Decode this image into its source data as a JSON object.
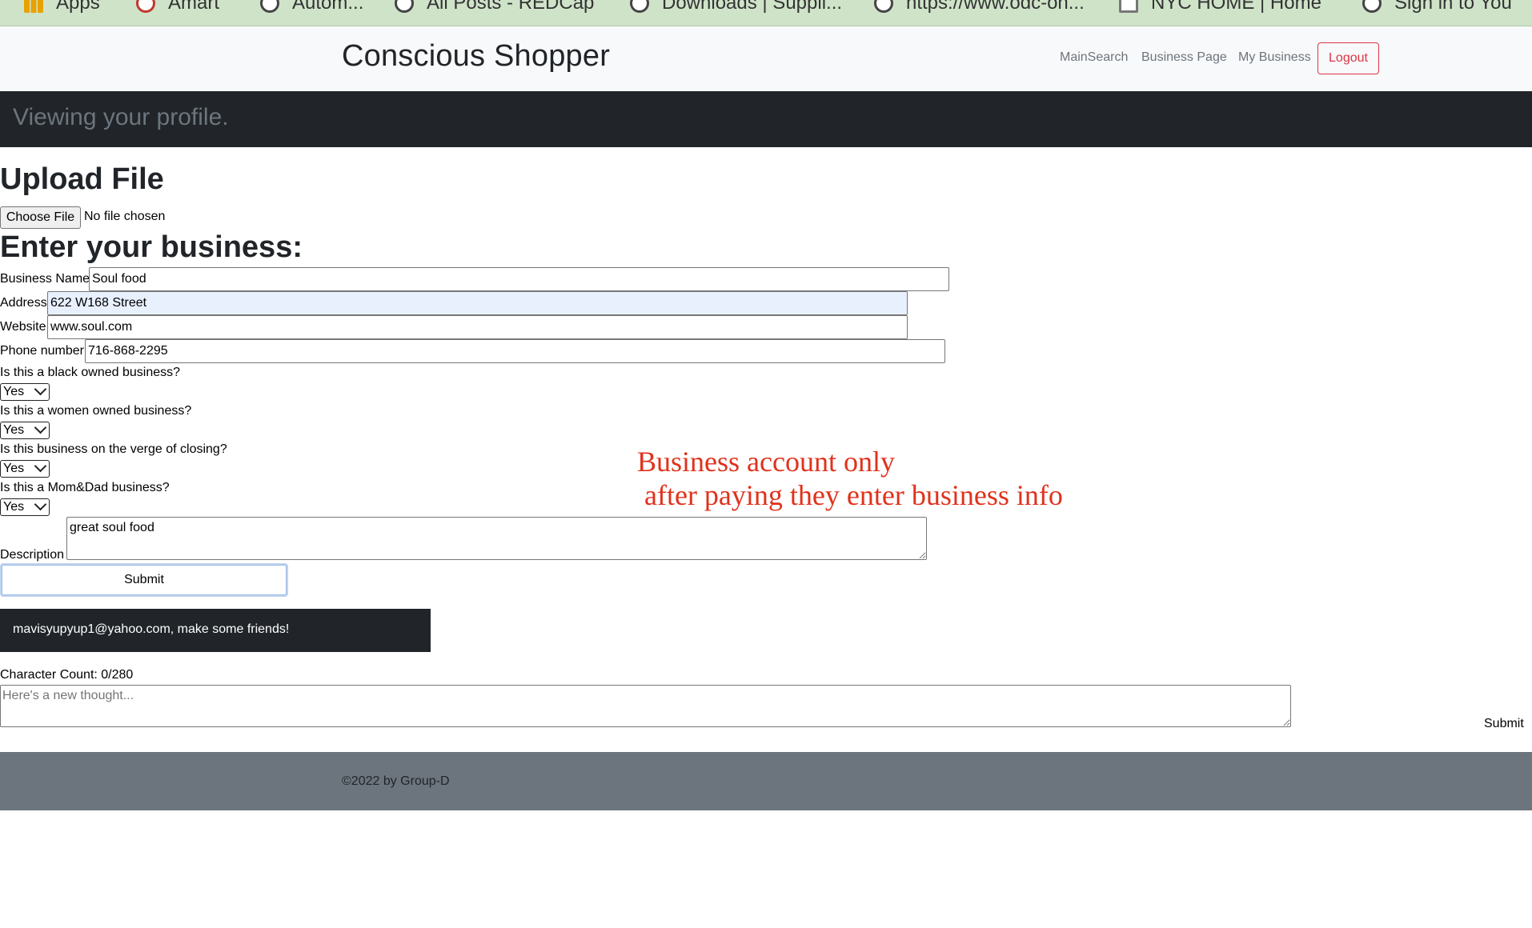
{
  "bookmarks": [
    {
      "label": "Apps",
      "icon": "apps-grid-icon"
    },
    {
      "label": "Amart",
      "icon": "magnifier-icon"
    },
    {
      "label": "Autom...",
      "icon": "globe-icon"
    },
    {
      "label": "All Posts - REDCap",
      "icon": "world-icon"
    },
    {
      "label": "Downloads | Suppli...",
      "icon": "globe-icon"
    },
    {
      "label": "https://www.odc-oh...",
      "icon": "globe-icon"
    },
    {
      "label": "NYC HOME | Home",
      "icon": "sheet-icon"
    },
    {
      "label": "Sign in to You",
      "icon": "globe-icon"
    }
  ],
  "navbar": {
    "brand": "Conscious Shopper",
    "links": [
      "MainSearch",
      "Business Page",
      "My Business"
    ],
    "logout": "Logout"
  },
  "banner": {
    "text": "Viewing your profile."
  },
  "upload": {
    "heading": "Upload File",
    "button": "Choose File",
    "status": "No file chosen"
  },
  "business_form": {
    "heading": "Enter your business:",
    "fields": {
      "name": {
        "label": "Business Name",
        "value": "Soul food"
      },
      "address": {
        "label": "Address",
        "value": "622 W168 Street"
      },
      "website": {
        "label": "Website",
        "value": "www.soul.com"
      },
      "phone": {
        "label": "Phone number",
        "value": "716-868-2295"
      }
    },
    "questions": [
      {
        "label": "Is this a black owned business?",
        "value": "Yes"
      },
      {
        "label": "Is this a women owned business?",
        "value": "Yes"
      },
      {
        "label": "Is this business on the verge of closing?",
        "value": "Yes"
      },
      {
        "label": "Is this a Mom&Dad business?",
        "value": "Yes"
      }
    ],
    "description": {
      "label": "Description",
      "value": "great soul food"
    },
    "submit": "Submit"
  },
  "annotation": {
    "line1": "Business account only",
    "line2": " after paying they enter business info",
    "color": "#e0321c"
  },
  "friends": {
    "text": "mavisyupyup1@yahoo.com, make some friends!"
  },
  "thought": {
    "char_count": "Character Count: 0/280",
    "placeholder": "Here's a new thought...",
    "submit": "Submit"
  },
  "footer": {
    "text": "©2022 by Group-D"
  },
  "colors": {
    "bookmarks_bg": "#cfe3c9",
    "navbar_bg": "#f8f9fa",
    "dark": "#212529",
    "muted": "#6c757d",
    "danger": "#dc3545",
    "autofill": "#e8f0fe"
  }
}
